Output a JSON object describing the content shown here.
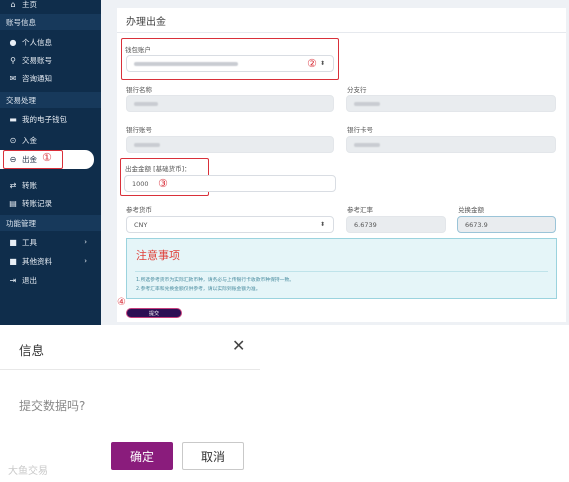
{
  "sidebar": {
    "home": {
      "icon": "home-icon",
      "label": "主页"
    },
    "sections": {
      "account": "账号信息",
      "trade": "交易处理",
      "functions": "功能管理"
    },
    "items": [
      {
        "icon": "user-icon",
        "label": "个人信息"
      },
      {
        "icon": "account-icon",
        "label": "交易账号"
      },
      {
        "icon": "mail-icon",
        "label": "咨询通知"
      },
      {
        "icon": "wallet-icon",
        "label": "我的电子钱包"
      },
      {
        "icon": "deposit-icon",
        "label": "入金"
      },
      {
        "icon": "withdraw-icon",
        "label": "出金"
      },
      {
        "icon": "transfer-icon",
        "label": "转账"
      },
      {
        "icon": "record-icon",
        "label": "转账记录"
      },
      {
        "icon": "tools-icon",
        "label": "工具"
      },
      {
        "icon": "other-icon",
        "label": "其他资料"
      },
      {
        "icon": "logout-icon",
        "label": "退出"
      }
    ],
    "active_marker": "①"
  },
  "form": {
    "title": "办理出金",
    "wallet_label": "钱包账户",
    "wallet_marker": "②",
    "bank_name_label": "银行名称",
    "branch_label": "分支行",
    "bank_account_label": "银行账号",
    "bank_card_label": "银行卡号",
    "amount_label": "出金金额 [基础货币]：",
    "amount_value": "1000",
    "amount_marker": "③",
    "currency_label": "参考货币",
    "currency_value": "CNY",
    "rate_label": "参考汇率",
    "rate_value": "6.6739",
    "exchange_label": "兑换金额",
    "exchange_value": "6673.9",
    "submit_label": "提交",
    "submit_marker": "④"
  },
  "notice": {
    "title": "注意事项",
    "line1": "1.所选参考货币为实际汇款币种，请务必与上传银行卡收款币种保持一致。",
    "line2": "2.参考汇率和兑换金额仅供参考，请以实际到账金额为准。"
  },
  "dialog": {
    "title": "信息",
    "close_icon": "close-icon",
    "message": "提交数据吗?",
    "ok_label": "确定",
    "cancel_label": "取消"
  },
  "watermark": "大鱼交易",
  "colors": {
    "sidebar_bg": "#0f2d4b",
    "accent_red": "#d9303a",
    "ok_button": "#8a1c7c",
    "submit_button": "#2c0f55"
  }
}
